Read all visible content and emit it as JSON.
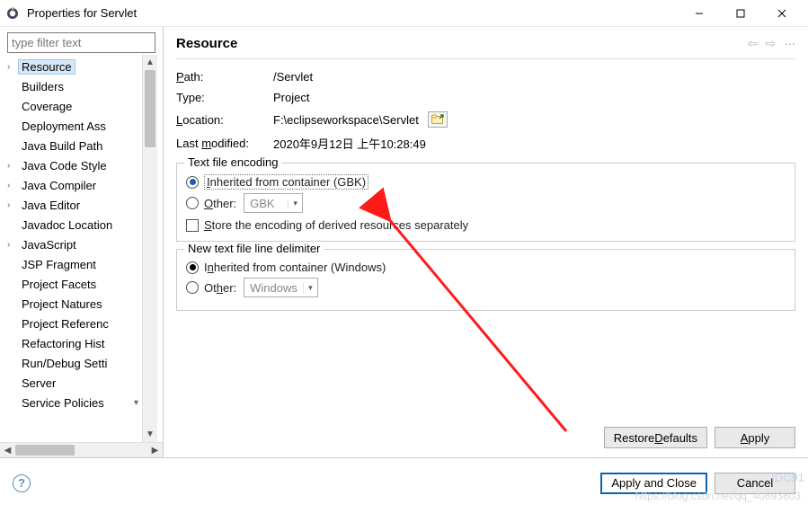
{
  "window": {
    "title": "Properties for Servlet"
  },
  "filter": {
    "placeholder": "type filter text"
  },
  "tree": {
    "items": [
      {
        "label": "Resource",
        "expandable": true,
        "selected": true
      },
      {
        "label": "Builders",
        "expandable": false
      },
      {
        "label": "Coverage",
        "expandable": false
      },
      {
        "label": "Deployment Ass",
        "expandable": false
      },
      {
        "label": "Java Build Path",
        "expandable": false
      },
      {
        "label": "Java Code Style",
        "expandable": true
      },
      {
        "label": "Java Compiler",
        "expandable": true
      },
      {
        "label": "Java Editor",
        "expandable": true
      },
      {
        "label": "Javadoc Location",
        "expandable": false
      },
      {
        "label": "JavaScript",
        "expandable": true
      },
      {
        "label": "JSP Fragment",
        "expandable": false
      },
      {
        "label": "Project Facets",
        "expandable": false
      },
      {
        "label": "Project Natures",
        "expandable": false
      },
      {
        "label": "Project Referenc",
        "expandable": false
      },
      {
        "label": "Refactoring Hist",
        "expandable": false
      },
      {
        "label": "Run/Debug Setti",
        "expandable": false
      },
      {
        "label": "Server",
        "expandable": false
      },
      {
        "label": "Service Policies",
        "expandable": false
      }
    ]
  },
  "header": {
    "title": "Resource"
  },
  "props": {
    "path_label": "Path:",
    "path_value": "/Servlet",
    "type_label": "Type:",
    "type_value": "Project",
    "location_label": "Location:",
    "location_value": "F:\\eclipseworkspace\\Servlet",
    "lastmod_label": "Last modified:",
    "lastmod_value": "2020年9月12日 上午10:28:49"
  },
  "encoding": {
    "legend": "Text file encoding",
    "inherited_label": "Inherited from container (GBK)",
    "other_label": "Other:",
    "other_value": "GBK",
    "store_label": "Store the encoding of derived resources separately"
  },
  "delimiter": {
    "legend": "New text file line delimiter",
    "inherited_label": "Inherited from container (Windows)",
    "other_label": "Other:",
    "other_value": "Windows"
  },
  "buttons": {
    "restore": "Restore Defaults",
    "apply": "Apply",
    "apply_close": "Apply and Close",
    "cancel": "Cancel"
  },
  "watermark": "https://blog.csdn.net/qq_40893803",
  "id91": "IDC91"
}
